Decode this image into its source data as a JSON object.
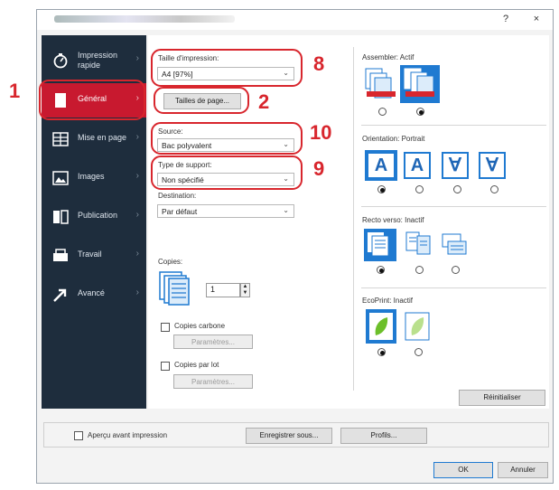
{
  "window": {
    "help_label": "?",
    "close_label": "×"
  },
  "annotations": {
    "n1": "1",
    "n2": "2",
    "n8": "8",
    "n9": "9",
    "n10": "10"
  },
  "sidebar": {
    "items": [
      {
        "label": "Impression rapide",
        "icon": "quick-print-icon"
      },
      {
        "label": "Général",
        "icon": "page-icon"
      },
      {
        "label": "Mise en page",
        "icon": "layout-icon"
      },
      {
        "label": "Images",
        "icon": "image-icon"
      },
      {
        "label": "Publication",
        "icon": "publication-icon"
      },
      {
        "label": "Travail",
        "icon": "job-icon"
      },
      {
        "label": "Avancé",
        "icon": "arrow-icon"
      }
    ]
  },
  "general": {
    "print_size_label": "Taille d'impression:",
    "print_size_value": "A4 [97%]",
    "page_sizes_button": "Tailles de page...",
    "source_label": "Source:",
    "source_value": "Bac polyvalent",
    "media_type_label": "Type de support:",
    "media_type_value": "Non spécifié",
    "destination_label": "Destination:",
    "destination_value": "Par défaut",
    "copies_label": "Copies:",
    "copies_value": "1",
    "carbon_copies_label": "Copies carbone",
    "carbon_params_button": "Paramètres...",
    "job_copies_label": "Copies par lot",
    "job_params_button": "Paramètres..."
  },
  "right": {
    "collate_label": "Assembler: Actif",
    "orientation_label": "Orientation: Portrait",
    "orientation_glyphs": [
      "A",
      "A",
      "∀",
      "∀"
    ],
    "duplex_label": "Recto verso: Inactif",
    "ecoprint_label": "EcoPrint: Inactif",
    "reset_button": "Réinitialiser"
  },
  "footer": {
    "preview_label": "Aperçu avant impression",
    "save_as_button": "Enregistrer sous...",
    "profiles_button": "Profils...",
    "ok_button": "OK",
    "cancel_button": "Annuler"
  },
  "colors": {
    "accent_red": "#d8262d",
    "sidebar_bg": "#1e2d3d",
    "active_red": "#c8192f",
    "icon_blue": "#1f7ad1"
  }
}
